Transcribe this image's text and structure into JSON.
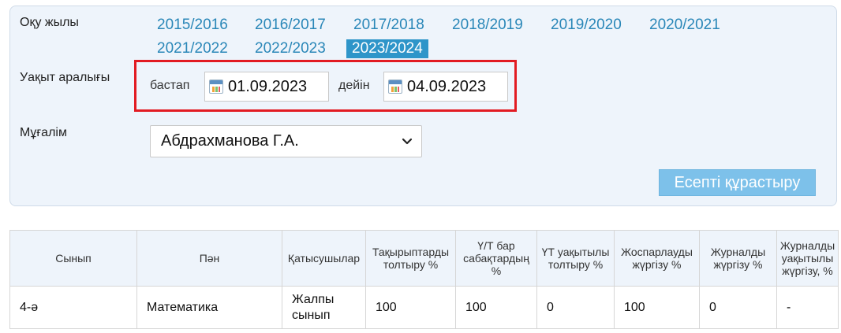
{
  "filters": {
    "year_label": "Оқу жылы",
    "years": [
      "2015/2016",
      "2016/2017",
      "2017/2018",
      "2018/2019",
      "2019/2020",
      "2020/2021",
      "2021/2022",
      "2022/2023",
      "2023/2024"
    ],
    "active_year": "2023/2024",
    "period_label": "Уақыт аралығы",
    "from_label": "бастап",
    "from_date": "01.09.2023",
    "to_label": "дейін",
    "to_date": "04.09.2023",
    "teacher_label": "Мұғалім",
    "teacher_value": "Абдрахманова Г.А.",
    "build_button": "Есепті құрастыру"
  },
  "table": {
    "headers": [
      "Сынып",
      "Пән",
      "Қатысушылар",
      "Тақырыптарды толтыру %",
      "Ү/Т бар сабақтардың %",
      "ҮТ уақытылы толтыру %",
      "Жоспарлауды жүргізу %",
      "Журналды жүргізу %",
      "Журналды уақытылы жүргізу, %"
    ],
    "rows": [
      [
        "4-ә",
        "Математика",
        "Жалпы сынып",
        "100",
        "100",
        "0",
        "100",
        "0",
        "-"
      ]
    ]
  },
  "colors": {
    "panel_bg": "#eef4fb",
    "link": "#2a87b8",
    "active_year_bg": "#2e95c9",
    "highlight_border": "#e21b22",
    "button_bg": "#7dc1ea"
  }
}
